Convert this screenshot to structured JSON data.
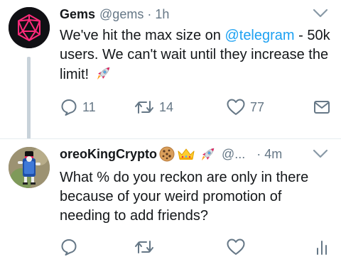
{
  "tweets": [
    {
      "name": "Gems",
      "handle": "@gems",
      "separator": "·",
      "time": "1h",
      "text_before": "We've hit the max size on ",
      "mention": "@telegram",
      "text_after": " - 50k users. We can't wait until they increase the limit!",
      "emoji": "rocket",
      "replies": "11",
      "retweets": "14",
      "likes": "77"
    },
    {
      "name": "oreoKingCrypto",
      "name_emojis": [
        "cookie",
        "crown",
        "rocket"
      ],
      "handle": "@...",
      "separator": "·",
      "time": "4m",
      "text": "What % do you reckon are only in there because of your weird promotion of needing to add friends?"
    }
  ],
  "icons": {
    "reply": "reply-icon",
    "retweet": "retweet-icon",
    "like": "heart-icon",
    "share": "envelope-icon",
    "analytics": "analytics-icon",
    "menu": "chevron-down-icon"
  },
  "colors": {
    "text": "#14171a",
    "secondary": "#657786",
    "link": "#1da1f2",
    "thread_line": "#c8d2da",
    "gem_pink": "#ff2a7a"
  }
}
